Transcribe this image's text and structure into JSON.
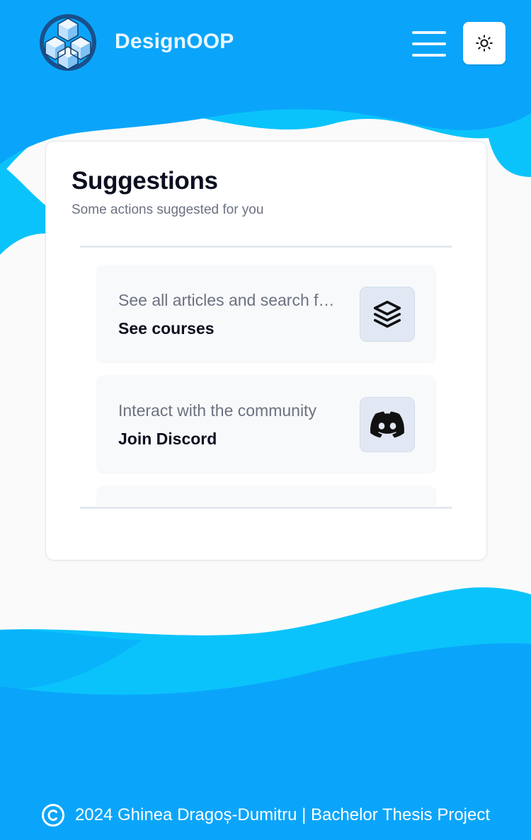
{
  "header": {
    "brand": "DesignOOP",
    "logo_icon": "cubes-logo",
    "menu_icon": "hamburger-menu-icon",
    "theme_icon": "sun-icon"
  },
  "suggestions": {
    "title": "Suggestions",
    "subtitle": "Some actions suggested for you",
    "items": [
      {
        "description": "See all articles and search for courses",
        "label": "See courses",
        "icon": "layers-icon"
      },
      {
        "description": "Interact with the community",
        "label": "Join Discord",
        "icon": "discord-icon"
      }
    ]
  },
  "footer": {
    "copyright_icon": "copyright-icon",
    "text": "2024 Ghinea Dragoș-Dumitru | Bachelor Thesis Project"
  },
  "colors": {
    "primary": "#0aa5fa",
    "wave_light": "#0bc3fb",
    "card_bg": "#ffffff",
    "item_bg": "#f8f9fb",
    "icon_bg": "#e1e8f4"
  }
}
